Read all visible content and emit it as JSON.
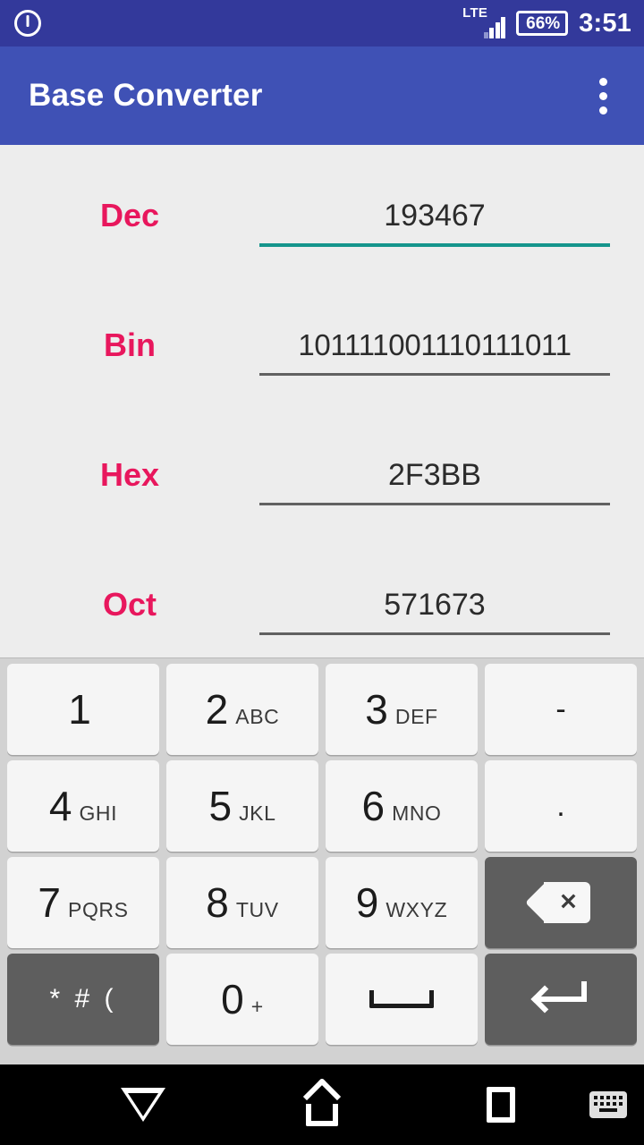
{
  "statusbar": {
    "power_icon": "power-circle-icon",
    "network_type": "LTE",
    "signal_icon": "signal-bars-icon",
    "battery_percent": "66%",
    "clock": "3:51"
  },
  "appbar": {
    "title": "Base Converter",
    "overflow_icon": "more-vertical-icon"
  },
  "converter": {
    "fields": [
      {
        "label": "Dec",
        "value": "193467",
        "base": 10,
        "focused": true
      },
      {
        "label": "Bin",
        "value": "101111001110111011",
        "base": 2,
        "focused": false
      },
      {
        "label": "Hex",
        "value": "2F3BB",
        "base": 16,
        "focused": false
      },
      {
        "label": "Oct",
        "value": "571673",
        "base": 8,
        "focused": false
      }
    ]
  },
  "keyboard": {
    "rows": [
      [
        {
          "digit": "1",
          "letters": ""
        },
        {
          "digit": "2",
          "letters": "ABC"
        },
        {
          "digit": "3",
          "letters": "DEF"
        },
        {
          "sym": "-"
        }
      ],
      [
        {
          "digit": "4",
          "letters": "GHI"
        },
        {
          "digit": "5",
          "letters": "JKL"
        },
        {
          "digit": "6",
          "letters": "MNO"
        },
        {
          "sym": "."
        }
      ],
      [
        {
          "digit": "7",
          "letters": "PQRS"
        },
        {
          "digit": "8",
          "letters": "TUV"
        },
        {
          "digit": "9",
          "letters": "WXYZ"
        },
        {
          "icon": "backspace-icon",
          "dark": true
        }
      ],
      [
        {
          "sym": "* # (",
          "dark": true
        },
        {
          "digit": "0",
          "letters": "+"
        },
        {
          "icon": "space-icon"
        },
        {
          "icon": "enter-icon",
          "dark": true
        }
      ]
    ]
  },
  "navbar": {
    "back_icon": "back-triangle-icon",
    "home_icon": "home-icon",
    "recents_icon": "recents-square-icon",
    "keyboard_icon": "keyboard-icon"
  },
  "colors": {
    "statusbar_bg": "#33399b",
    "appbar_bg": "#3f51b5",
    "content_bg": "#ededed",
    "label_pink": "#e8175d",
    "accent_teal": "#15958c",
    "underline_gray": "#616161",
    "keyboard_bg": "#d2d2d2",
    "key_bg": "#f5f5f5",
    "key_dark_bg": "#5e5e5e",
    "navbar_bg": "#000000"
  }
}
